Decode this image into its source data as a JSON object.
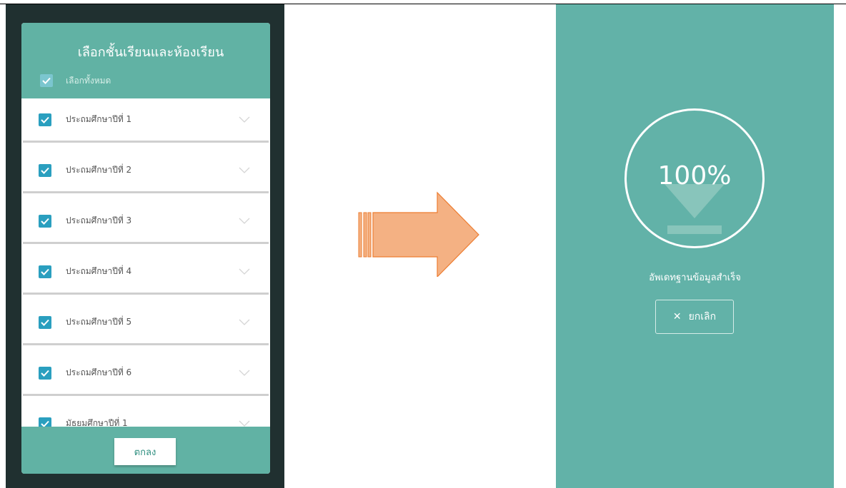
{
  "dialog": {
    "title": "เลือกชั้นเรียนและห้องเรียน",
    "select_all_label": "เลือกทั้งหมด",
    "items": [
      {
        "label": "ประถมศึกษาปีที่ 1",
        "checked": true
      },
      {
        "label": "ประถมศึกษาปีที่ 2",
        "checked": true
      },
      {
        "label": "ประถมศึกษาปีที่ 3",
        "checked": true
      },
      {
        "label": "ประถมศึกษาปีที่ 4",
        "checked": true
      },
      {
        "label": "ประถมศึกษาปีที่ 5",
        "checked": true
      },
      {
        "label": "ประถมศึกษาปีที่ 6",
        "checked": true
      },
      {
        "label": "มัธยมศึกษาปีที่ 1",
        "checked": true
      }
    ],
    "ok_label": "ตกลง"
  },
  "progress": {
    "percent_text": "100%",
    "value": 1.0,
    "status": "อัพเดทฐานข้อมูลสำเร็จ",
    "cancel_label": "ยกเลิก",
    "cancel_icon": "close-icon"
  },
  "colors": {
    "teal": "#61b2a4",
    "dark_bg": "#203030",
    "checkbox": "#2a9fbf",
    "arrow_fill": "#f4b183",
    "arrow_stroke": "#ed7d31"
  }
}
